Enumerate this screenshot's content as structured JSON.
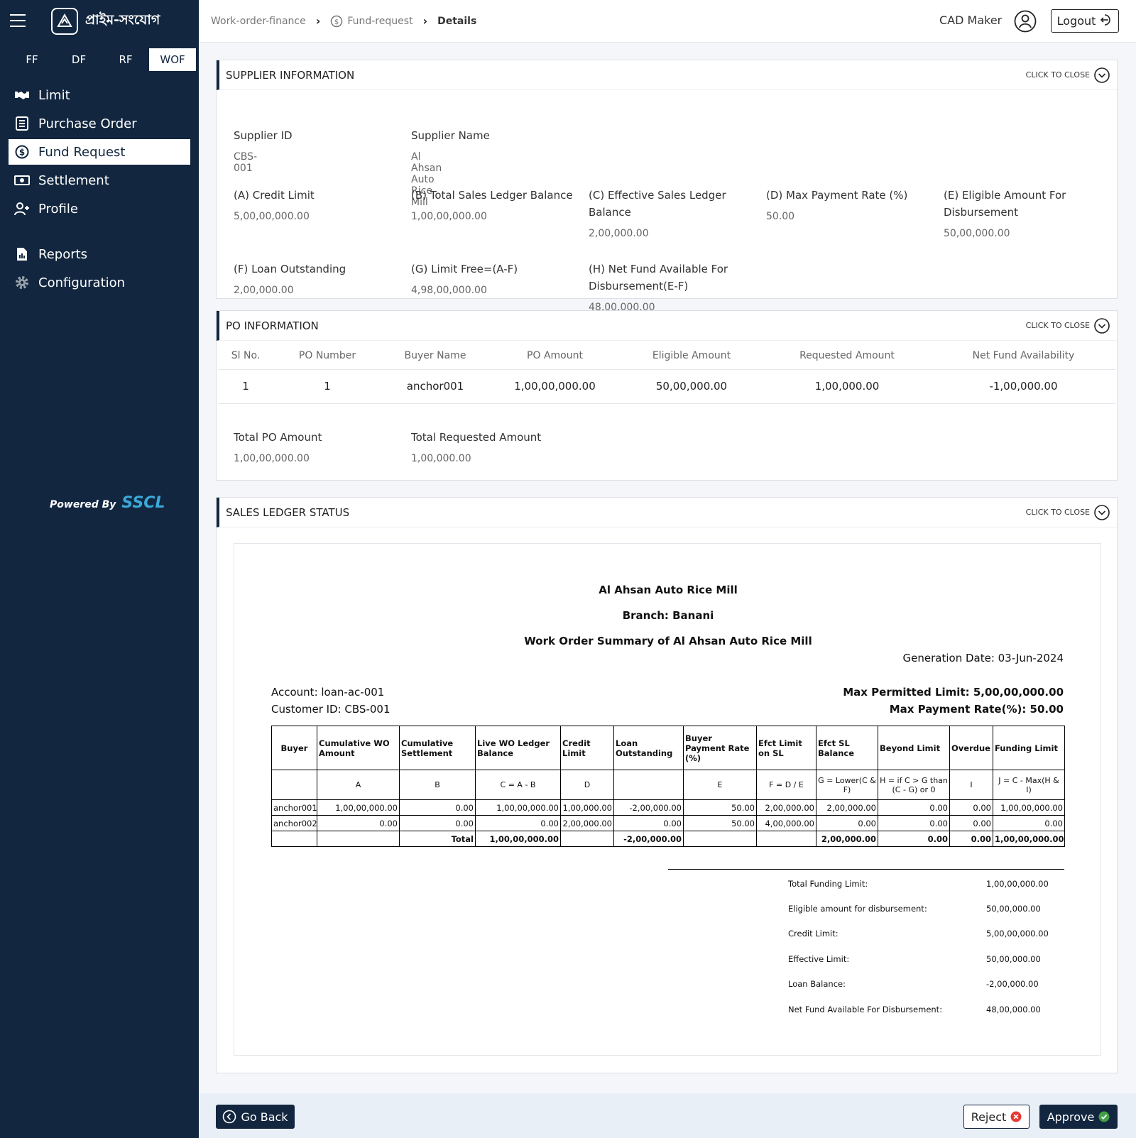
{
  "app": {
    "brand": "প্রাইম-সংযোগ",
    "powered_by": "Powered By",
    "powered_brand": "SSCL"
  },
  "module_tabs": [
    "FF",
    "DF",
    "RF",
    "WOF"
  ],
  "nav": {
    "items": [
      {
        "label": "Limit",
        "icon": "handshake-icon"
      },
      {
        "label": "Purchase Order",
        "icon": "document-icon"
      },
      {
        "label": "Fund Request",
        "icon": "dollar-circle-icon"
      },
      {
        "label": "Settlement",
        "icon": "cash-icon"
      },
      {
        "label": "Profile",
        "icon": "user-add-icon"
      },
      {
        "label": "Reports",
        "icon": "report-icon"
      },
      {
        "label": "Configuration",
        "icon": "gear-icon"
      }
    ]
  },
  "breadcrumb": [
    "Work-order-finance",
    "Fund-request",
    "Details"
  ],
  "header": {
    "user": "CAD Maker",
    "logout": "Logout"
  },
  "close_label": "CLICK TO CLOSE",
  "supplier": {
    "title": "SUPPLIER INFORMATION",
    "fields": [
      {
        "label": "Supplier ID",
        "value": "CBS-001"
      },
      {
        "label": "Supplier Name",
        "value": "Al Ahsan Auto Rice Mill"
      },
      {
        "label": "(A) Credit Limit",
        "value": "5,00,00,000.00"
      },
      {
        "label": "(B) Total Sales Ledger Balance",
        "value": "1,00,00,000.00"
      },
      {
        "label": "(C) Effective Sales Ledger Balance",
        "value": "2,00,000.00"
      },
      {
        "label": "(D) Max Payment Rate (%)",
        "value": "50.00"
      },
      {
        "label": "(E) Eligible Amount For Disbursement",
        "value": "50,00,000.00"
      },
      {
        "label": "(F) Loan Outstanding",
        "value": "2,00,000.00"
      },
      {
        "label": "(G) Limit Free=(A-F)",
        "value": "4,98,00,000.00"
      },
      {
        "label": "(H) Net Fund Available For Disbursement(E-F)",
        "value": "48,00,000.00"
      }
    ]
  },
  "po": {
    "title": "PO INFORMATION",
    "columns": [
      "Sl No.",
      "PO Number",
      "Buyer Name",
      "PO Amount",
      "Eligible Amount",
      "Requested Amount",
      "Net Fund Availability"
    ],
    "rows": [
      [
        "1",
        "1",
        "anchor001",
        "1,00,00,000.00",
        "50,00,000.00",
        "1,00,000.00",
        "-1,00,000.00"
      ]
    ],
    "total_po_label": "Total PO Amount",
    "total_po_value": "1,00,00,000.00",
    "total_req_label": "Total Requested Amount",
    "total_req_value": "1,00,000.00"
  },
  "ledger": {
    "title": "SALES LEDGER STATUS",
    "company": "Al Ahsan Auto Rice Mill",
    "branch": "Branch: Banani",
    "summary_title": "Work Order Summary of Al Ahsan Auto Rice Mill",
    "generation_date": "Generation Date: 03-Jun-2024",
    "account": "Account: loan-ac-001",
    "customer_id": "Customer ID: CBS-001",
    "max_limit": "Max Permitted Limit: 5,00,00,000.00",
    "max_rate": "Max Payment Rate(%): 50.00",
    "table": {
      "headers": [
        "Buyer",
        "Cumulative WO Amount",
        "Cumulative Settlement",
        "Live WO Ledger Balance",
        "Credit Limit",
        "Loan Outstanding",
        "Buyer Payment Rate (%)",
        "Efct Limit on SL",
        "Efct SL Balance",
        "Beyond Limit",
        "Overdue",
        "Funding Limit"
      ],
      "formulas": [
        "",
        "A",
        "B",
        "C = A - B",
        "D",
        "",
        "E",
        "F = D / E",
        "G = Lower(C & F)",
        "H = if C > G than (C - G) or 0",
        "I",
        "J = C - Max(H & I)"
      ],
      "rows": [
        [
          "anchor001",
          "1,00,00,000.00",
          "0.00",
          "1,00,00,000.00",
          "1,00,000.00",
          "-2,00,000.00",
          "50.00",
          "2,00,000.00",
          "2,00,000.00",
          "0.00",
          "0.00",
          "1,00,00,000.00"
        ],
        [
          "anchor002",
          "0.00",
          "0.00",
          "0.00",
          "2,00,000.00",
          "0.00",
          "50.00",
          "4,00,000.00",
          "0.00",
          "0.00",
          "0.00",
          "0.00"
        ]
      ],
      "total": [
        "",
        "",
        "Total",
        "1,00,00,000.00",
        "",
        "-2,00,000.00",
        "",
        "",
        "2,00,000.00",
        "0.00",
        "0.00",
        "1,00,00,000.00"
      ]
    },
    "summary": [
      {
        "label": "Total Funding Limit:",
        "value": "1,00,00,000.00"
      },
      {
        "label": "Eligible amount for disbursement:",
        "value": "50,00,000.00"
      },
      {
        "label": "Credit Limit:",
        "value": "5,00,00,000.00"
      },
      {
        "label": "Effective Limit:",
        "value": "50,00,000.00"
      },
      {
        "label": "Loan Balance:",
        "value": "-2,00,000.00"
      },
      {
        "label": "Net Fund Available For Disbursement:",
        "value": "48,00,000.00"
      }
    ]
  },
  "footer": {
    "back": "Go Back",
    "reject": "Reject",
    "approve": "Approve"
  }
}
